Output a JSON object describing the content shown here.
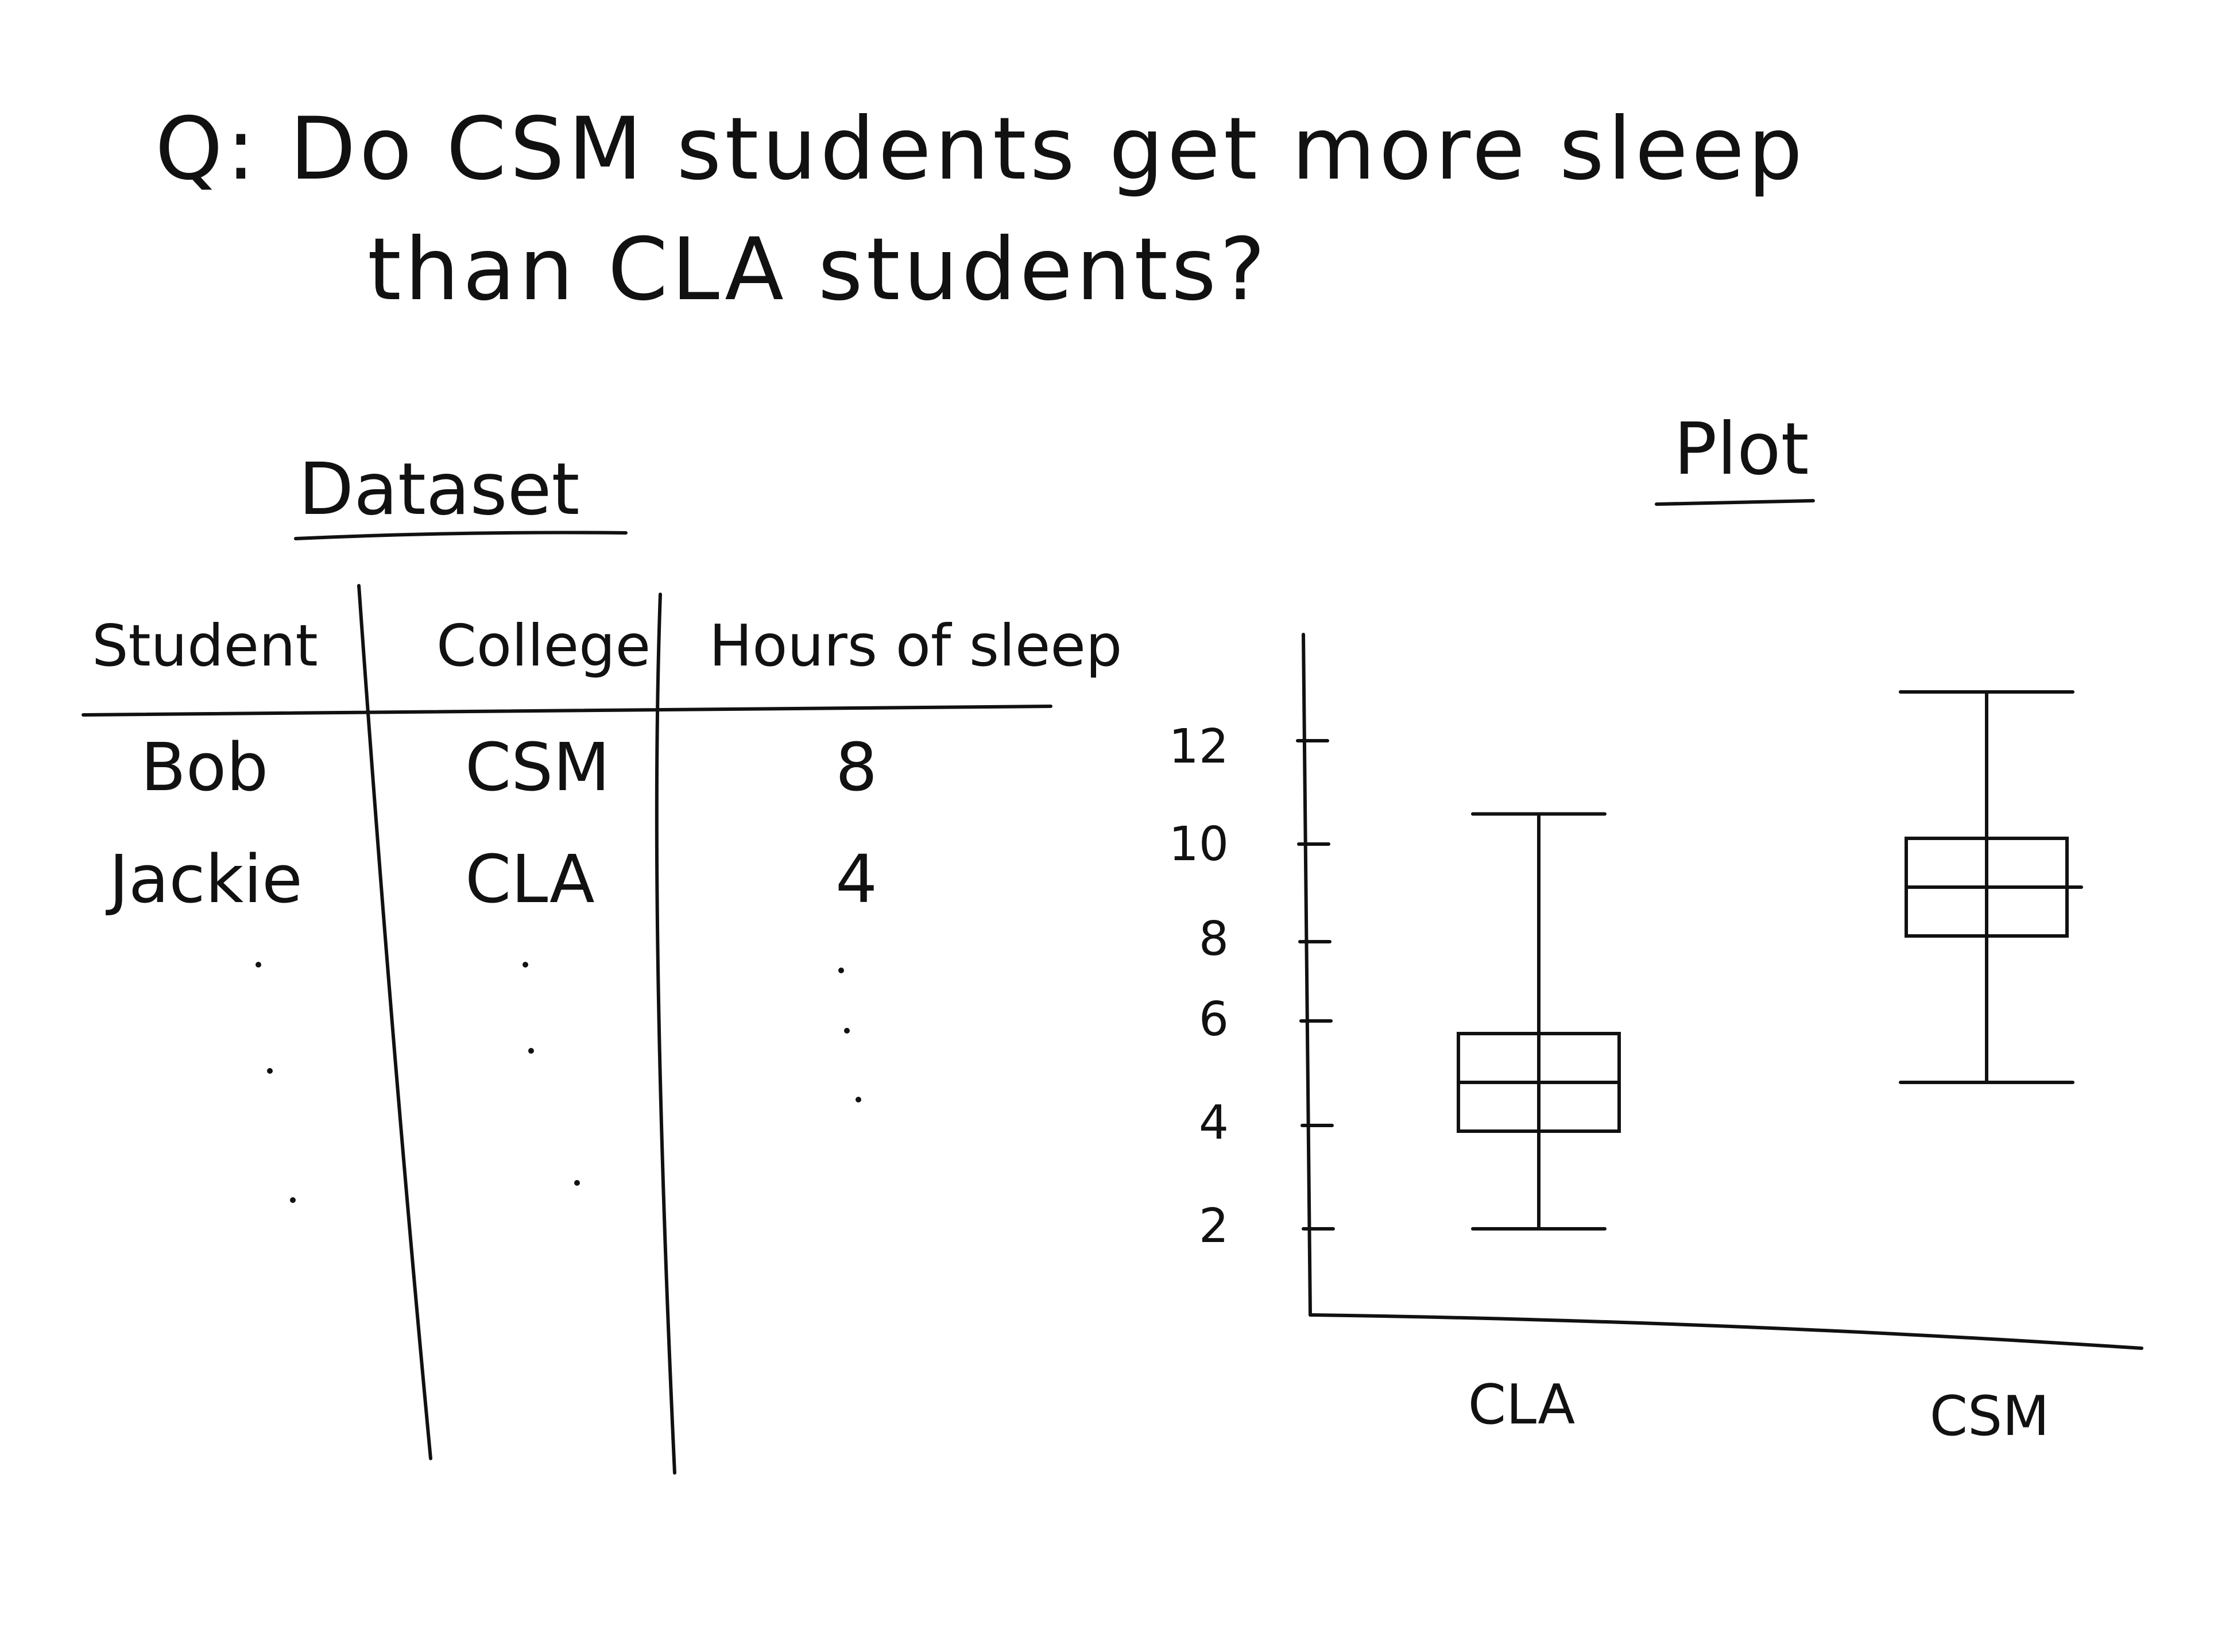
{
  "question": {
    "line1": "Q: Do CSM students get more sleep",
    "line2": "than CLA students?"
  },
  "dataset": {
    "heading": "Dataset",
    "columns": [
      "Student",
      "College",
      "Hours of sleep"
    ],
    "rows": [
      [
        "Bob",
        "CSM",
        "8"
      ],
      [
        "Jackie",
        "CLA",
        "4"
      ]
    ]
  },
  "plot": {
    "heading": "Plot"
  },
  "chart_data": {
    "type": "box",
    "title": "",
    "xlabel": "",
    "ylabel": "",
    "ylim": [
      0,
      14
    ],
    "yticks": [
      "2",
      "4",
      "6",
      "8",
      "10",
      "12"
    ],
    "categories": [
      "CLA",
      "CSM"
    ],
    "series": [
      {
        "category": "CLA",
        "min": 2,
        "q1": 4,
        "median": 5,
        "q3": 6,
        "max": 10.5
      },
      {
        "category": "CSM",
        "min": 5,
        "q1": 8,
        "median": 9,
        "q3": 10,
        "max": 13
      }
    ],
    "grid": false
  },
  "colors": {
    "ink": "#111111",
    "paper": "#ffffff"
  }
}
